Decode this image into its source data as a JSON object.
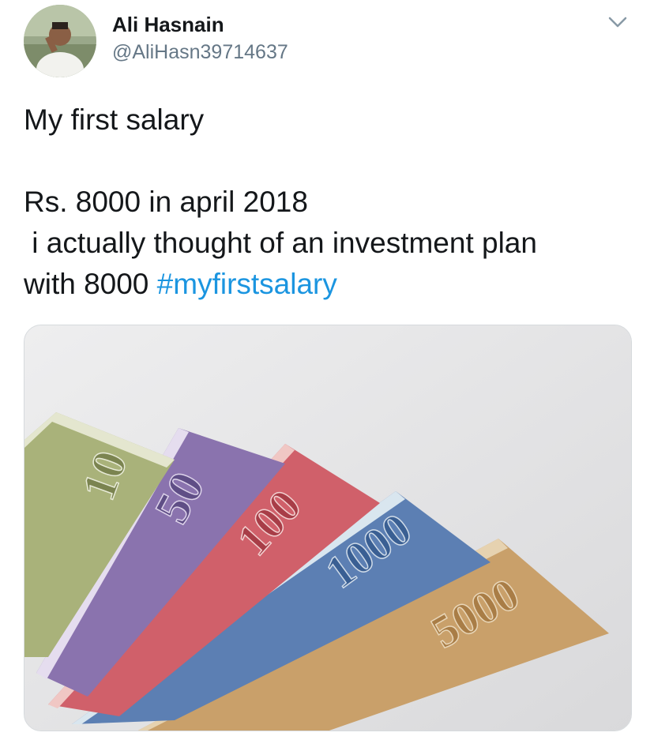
{
  "user": {
    "display_name": "Ali Hasnain",
    "handle": "@AliHasn39714637"
  },
  "tweet": {
    "line1": "My first salary",
    "line2": "Rs. 8000 in april 2018",
    "line3": " i actually thought of an investment plan",
    "line4_prefix": "with 8000 ",
    "hashtag": "#myfirstsalary"
  },
  "media": {
    "note_labels": [
      "10",
      "50",
      "100",
      "1000",
      "5000"
    ]
  },
  "colors": {
    "text": "#14171a",
    "secondary": "#657786",
    "link": "#1b95e0"
  },
  "icons": {
    "menu": "chevron-down-icon"
  }
}
